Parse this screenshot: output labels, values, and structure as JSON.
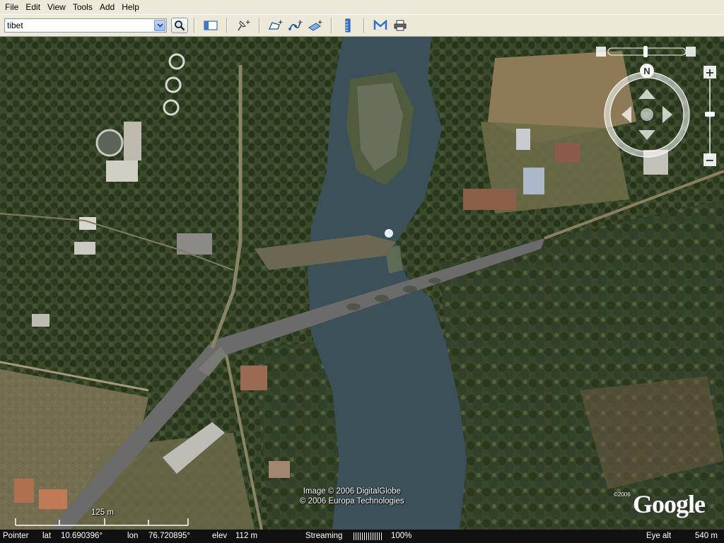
{
  "menu": {
    "items": [
      "File",
      "Edit",
      "View",
      "Tools",
      "Add",
      "Help"
    ]
  },
  "toolbar": {
    "search_value": "tibet",
    "icons": [
      "search-icon",
      "sidebar-toggle-icon",
      "placemark-icon",
      "polygon-icon",
      "path-icon",
      "image-overlay-icon",
      "ruler-icon",
      "email-icon",
      "print-icon"
    ]
  },
  "map": {
    "attribution_line1": "Image © 2006 DigitalGlobe",
    "attribution_line2": "© 2006 Europa Technologies",
    "logo_year": "©2006",
    "logo_text": "Google",
    "scale_label": "125 m",
    "compass_label": "N",
    "zoom_in": "+",
    "zoom_out": "−"
  },
  "status": {
    "pointer_label": "Pointer",
    "lat_label": "lat",
    "lat_value": "10.690396°",
    "lon_label": "lon",
    "lon_value": "76.720895°",
    "elev_label": "elev",
    "elev_value": "112 m",
    "streaming_label": "Streaming",
    "streaming_percent": "100%",
    "eye_alt_label": "Eye alt",
    "eye_alt_value": "540 m"
  },
  "colors": {
    "river": "#3b5059",
    "vegetation_dark": "#2f3d22",
    "field": "#8a7a57",
    "road": "#6b6b6b"
  }
}
